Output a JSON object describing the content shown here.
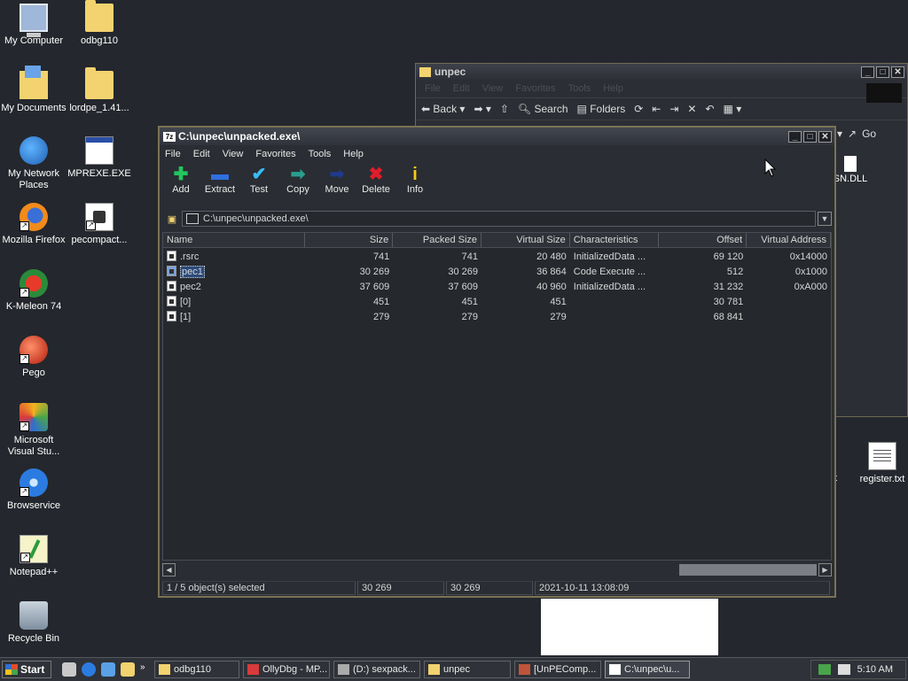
{
  "desktop": {
    "icons": [
      {
        "label": "My Computer"
      },
      {
        "label": "My Documents"
      },
      {
        "label": "My Network Places"
      },
      {
        "label": "Mozilla Firefox"
      },
      {
        "label": "K-Meleon 74"
      },
      {
        "label": "Pego"
      },
      {
        "label": "Microsoft Visual Stu..."
      },
      {
        "label": "Browservice"
      },
      {
        "label": "Notepad++"
      },
      {
        "label": "Recycle Bin"
      },
      {
        "label": "odbg110"
      },
      {
        "label": "lordpe_1.41..."
      },
      {
        "label": "MPREXE.EXE"
      },
      {
        "label": "pecompact..."
      },
      {
        "label": "register.txt"
      }
    ]
  },
  "bg_window": {
    "title": "unpec",
    "menu": [
      "File",
      "Edit",
      "View",
      "Favorites",
      "Tools",
      "Help"
    ],
    "toolbar": {
      "back": "Back",
      "search": "Search",
      "folders": "Folders",
      "go": "Go"
    },
    "partial_file": "SN.DLL",
    "partial_text": "t"
  },
  "zip_window": {
    "title": "C:\\unpec\\unpacked.exe\\",
    "menu": [
      "File",
      "Edit",
      "View",
      "Favorites",
      "Tools",
      "Help"
    ],
    "toolbar": [
      {
        "label": "Add",
        "icon": "add-icon",
        "glyph": "✚",
        "color": "#22c55e"
      },
      {
        "label": "Extract",
        "icon": "extract-icon",
        "glyph": "▬",
        "color": "#2f6fe0"
      },
      {
        "label": "Test",
        "icon": "test-icon",
        "glyph": "✔",
        "color": "#38bdf8"
      },
      {
        "label": "Copy",
        "icon": "copy-icon",
        "glyph": "➡",
        "color": "#2a9d8f"
      },
      {
        "label": "Move",
        "icon": "move-icon",
        "glyph": "➡",
        "color": "#1e3a8a"
      },
      {
        "label": "Delete",
        "icon": "delete-icon",
        "glyph": "✖",
        "color": "#e11d2a"
      },
      {
        "label": "Info",
        "icon": "info-icon",
        "glyph": "i",
        "color": "#facc15"
      }
    ],
    "address": "C:\\unpec\\unpacked.exe\\",
    "columns": [
      "Name",
      "Size",
      "Packed Size",
      "Virtual Size",
      "Characteristics",
      "Offset",
      "Virtual Address"
    ],
    "rows": [
      {
        "name": ".rsrc",
        "size": "741",
        "packed": "741",
        "vsize": "20 480",
        "chars": "InitializedData ...",
        "offset": "69 120",
        "vaddr": "0x14000"
      },
      {
        "name": "pec1",
        "size": "30 269",
        "packed": "30 269",
        "vsize": "36 864",
        "chars": "Code Execute ...",
        "offset": "512",
        "vaddr": "0x1000"
      },
      {
        "name": "pec2",
        "size": "37 609",
        "packed": "37 609",
        "vsize": "40 960",
        "chars": "InitializedData ...",
        "offset": "31 232",
        "vaddr": "0xA000"
      },
      {
        "name": "[0]",
        "size": "451",
        "packed": "451",
        "vsize": "451",
        "chars": "",
        "offset": "30 781",
        "vaddr": ""
      },
      {
        "name": "[1]",
        "size": "279",
        "packed": "279",
        "vsize": "279",
        "chars": "",
        "offset": "68 841",
        "vaddr": ""
      }
    ],
    "selected_row": 1,
    "status": {
      "selection": "1 / 5 object(s) selected",
      "size": "30 269",
      "packed": "30 269",
      "modified": "2021-10-11 13:08:09"
    }
  },
  "taskbar": {
    "start": "Start",
    "tasks": [
      "odbg110",
      "OllyDbg - MP...",
      "(D:) sexpack...",
      "unpec",
      "[UnPEComp...",
      "C:\\unpec\\u..."
    ],
    "clock": "5:10 AM"
  }
}
